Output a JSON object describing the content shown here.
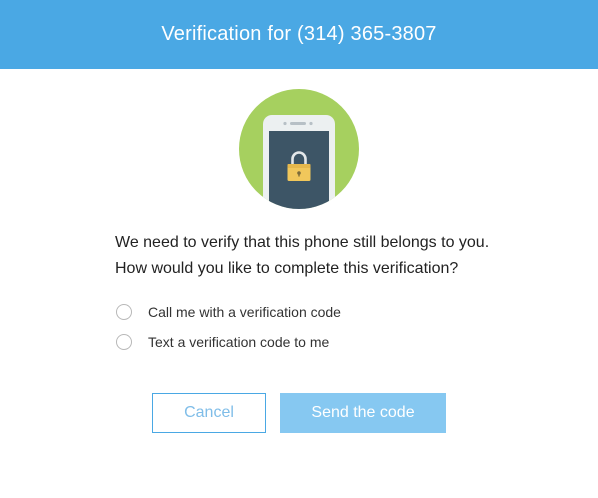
{
  "dialog": {
    "title": "Verification for (314) 365-3807",
    "message_line1": "We need to verify that this phone still belongs to you.",
    "message_line2": "How would you like to complete this verification?",
    "options": [
      {
        "label": "Call me with a verification code",
        "selected": false
      },
      {
        "label": "Text a verification code to me",
        "selected": false
      }
    ],
    "cancel_label": "Cancel",
    "send_label": "Send the code",
    "illustration_icon": "phone-lock-icon"
  },
  "colors": {
    "header_bg": "#4aa8e4",
    "circle_bg": "#a6d05f",
    "phone_body": "#ecf0f1",
    "phone_screen": "#3d5566",
    "lock_body": "#f1c75b",
    "send_button_bg": "#86c8f1",
    "cancel_border": "#4aa8e4"
  }
}
